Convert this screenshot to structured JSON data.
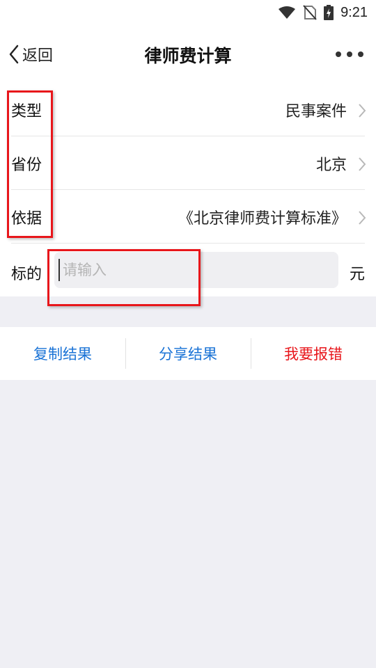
{
  "status_bar": {
    "time": "9:21",
    "icons": [
      "wifi-icon",
      "no-sim-icon",
      "battery-charging-icon"
    ]
  },
  "header": {
    "back_label": "返回",
    "title": "律师费计算",
    "more_icon": "more-dots-icon"
  },
  "form": {
    "rows": [
      {
        "label": "类型",
        "value": "民事案件"
      },
      {
        "label": "省份",
        "value": "北京"
      },
      {
        "label": "依据",
        "value": "《北京律师费计算标准》"
      }
    ],
    "amount": {
      "label": "标的",
      "placeholder": "请输入",
      "value": "",
      "unit": "元"
    }
  },
  "actions": {
    "copy": {
      "label": "复制结果",
      "color": "#1a73d6"
    },
    "share": {
      "label": "分享结果",
      "color": "#1a73d6"
    },
    "report": {
      "label": "我要报错",
      "color": "#e8161b"
    }
  },
  "colors": {
    "accent": "#1a73d6",
    "danger": "#e8161b",
    "background": "#efeff4",
    "highlight": "#e8161b"
  }
}
